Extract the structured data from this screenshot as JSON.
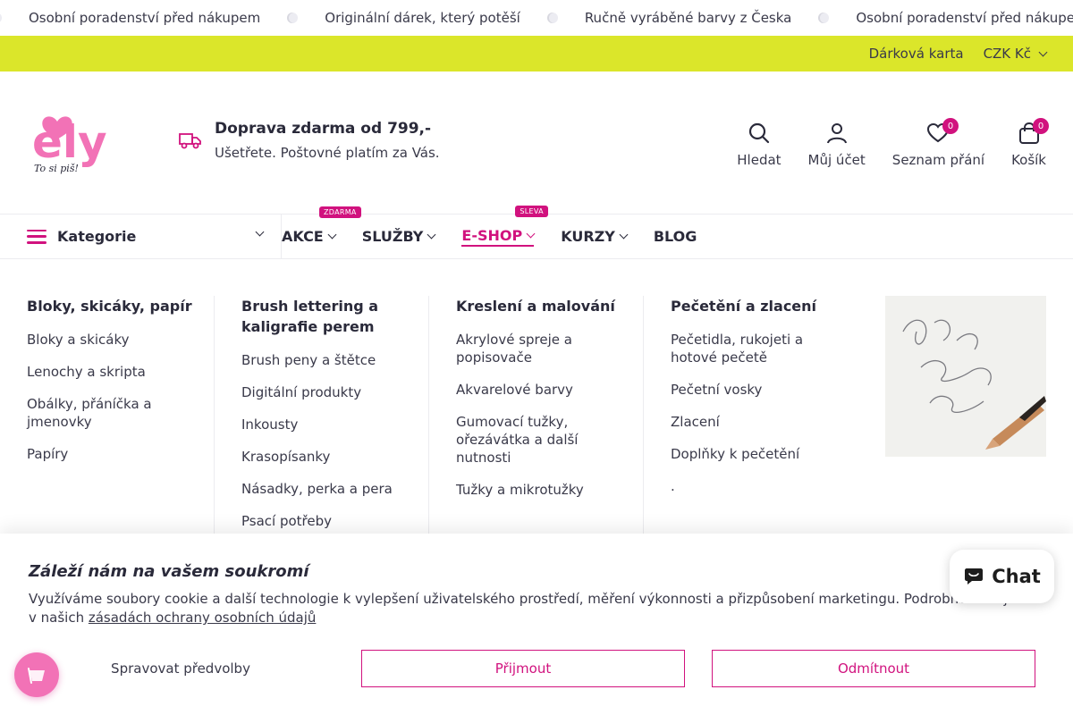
{
  "marquee": {
    "items": [
      "Osobní poradenství před nákupem",
      "Originální dárek, který potěší",
      "Ručně vyráběné barvy z Česka",
      "Osobní poradenství před nákupem"
    ]
  },
  "topbar": {
    "gift_card": "Dárková karta",
    "currency": "CZK Kč"
  },
  "header": {
    "logo_text": "ely",
    "logo_tagline": "To si piš!",
    "shipping_title": "Doprava zdarma od 799,-",
    "shipping_sub": "Ušetřete. Poštovné platím za Vás.",
    "actions": {
      "search": "Hledat",
      "account": "Můj účet",
      "wishlist": "Seznam přání",
      "wishlist_count": "0",
      "cart": "Košík",
      "cart_count": "0"
    }
  },
  "nav": {
    "categories": "Kategorie",
    "items": [
      {
        "label": "AKCE",
        "tag": "ZDARMA"
      },
      {
        "label": "SLUŽBY",
        "tag": ""
      },
      {
        "label": "E-SHOP",
        "tag": "SLEVA"
      },
      {
        "label": "KURZY",
        "tag": ""
      },
      {
        "label": "BLOG",
        "tag": ""
      }
    ]
  },
  "mega": {
    "columns": [
      {
        "title": "Bloky, skicáky, papír",
        "links": [
          "Bloky a skicáky",
          "Lenochy a skripta",
          "Obálky, přáníčka a jmenovky",
          "Papíry"
        ]
      },
      {
        "title": "Brush lettering a kaligrafie perem",
        "links": [
          "Brush peny a štětce",
          "Digitální produkty",
          "Inkousty",
          "Krasopísanky",
          "Násadky, perka a pera",
          "Psací potřeby"
        ]
      },
      {
        "title": "Kreslení a malování",
        "links": [
          "Akrylové spreje a popisovače",
          "Akvarelové barvy",
          "Gumovací tužky, ořezávátka a další nutnosti",
          "Tužky a mikrotužky"
        ]
      },
      {
        "title": "Pečetění a zlacení",
        "links": [
          "Pečetidla, rukojeti a hotové pečetě",
          "Pečetní vosky",
          "Zlacení",
          "Doplňky k pečetění",
          "."
        ]
      }
    ]
  },
  "cookie": {
    "title": "Záleží nám na vašem soukromí",
    "text": "Využíváme soubory cookie a další technologie k vylepšení uživatelského prostředí, měření výkonnosti a přizpůsobení marketingu. Podrobnosti najdete v našich ",
    "link": "zásadách ochrany osobních údajů",
    "manage": "Spravovat předvolby",
    "accept": "Přijmout",
    "decline": "Odmítnout"
  },
  "chat": {
    "label": "Chat"
  },
  "colors": {
    "brand": "#d1127e",
    "lime": "#dbe62a",
    "logo_blue": "#29b6e8"
  }
}
